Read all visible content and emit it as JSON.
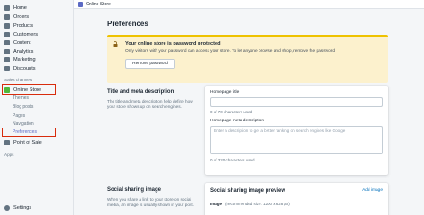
{
  "sidebar": {
    "items": [
      {
        "label": "Home",
        "icon": "home-icon"
      },
      {
        "label": "Orders",
        "icon": "orders-icon"
      },
      {
        "label": "Products",
        "icon": "products-icon"
      },
      {
        "label": "Customers",
        "icon": "customers-icon"
      },
      {
        "label": "Content",
        "icon": "content-icon"
      },
      {
        "label": "Analytics",
        "icon": "analytics-icon"
      },
      {
        "label": "Marketing",
        "icon": "marketing-icon"
      },
      {
        "label": "Discounts",
        "icon": "discounts-icon"
      }
    ],
    "sales_channels_label": "Sales channels",
    "online_store": {
      "label": "Online Store",
      "icon": "store-icon"
    },
    "online_store_sub": [
      "Themes",
      "Blog posts",
      "Pages",
      "Navigation",
      "Preferences"
    ],
    "point_of_sale": {
      "label": "Point of Sale",
      "icon": "pos-icon"
    },
    "apps_label": "Apps",
    "settings": {
      "label": "Settings",
      "icon": "gear-icon"
    },
    "highlight_color": "#d82c0d"
  },
  "topbar": {
    "title": "Online Store"
  },
  "main": {
    "title": "Preferences",
    "banner": {
      "title": "Your online store is password protected",
      "text": "Only visitors with your password can access your store. To let anyone browse and shop, remove the password.",
      "button": "Remove password"
    },
    "title_meta": {
      "heading": "Title and meta description",
      "description": "The title and meta description help define how your store shows up on search engines.",
      "homepage_title_label": "Homepage title",
      "homepage_title_value": "",
      "homepage_title_help": "0 of 70 characters used",
      "meta_label": "Homepage meta description",
      "meta_placeholder": "Enter a description to get a better ranking on search engines like Google",
      "meta_help": "0 of 320 characters used"
    },
    "social": {
      "heading": "Social sharing image",
      "description": "When you share a link to your store on social media, an image is usually shown in your post.",
      "card_title": "Social sharing image preview",
      "card_link": "Add image",
      "image_label": "Image",
      "image_hint": "(recommended size: 1200 x 628 px)"
    }
  }
}
